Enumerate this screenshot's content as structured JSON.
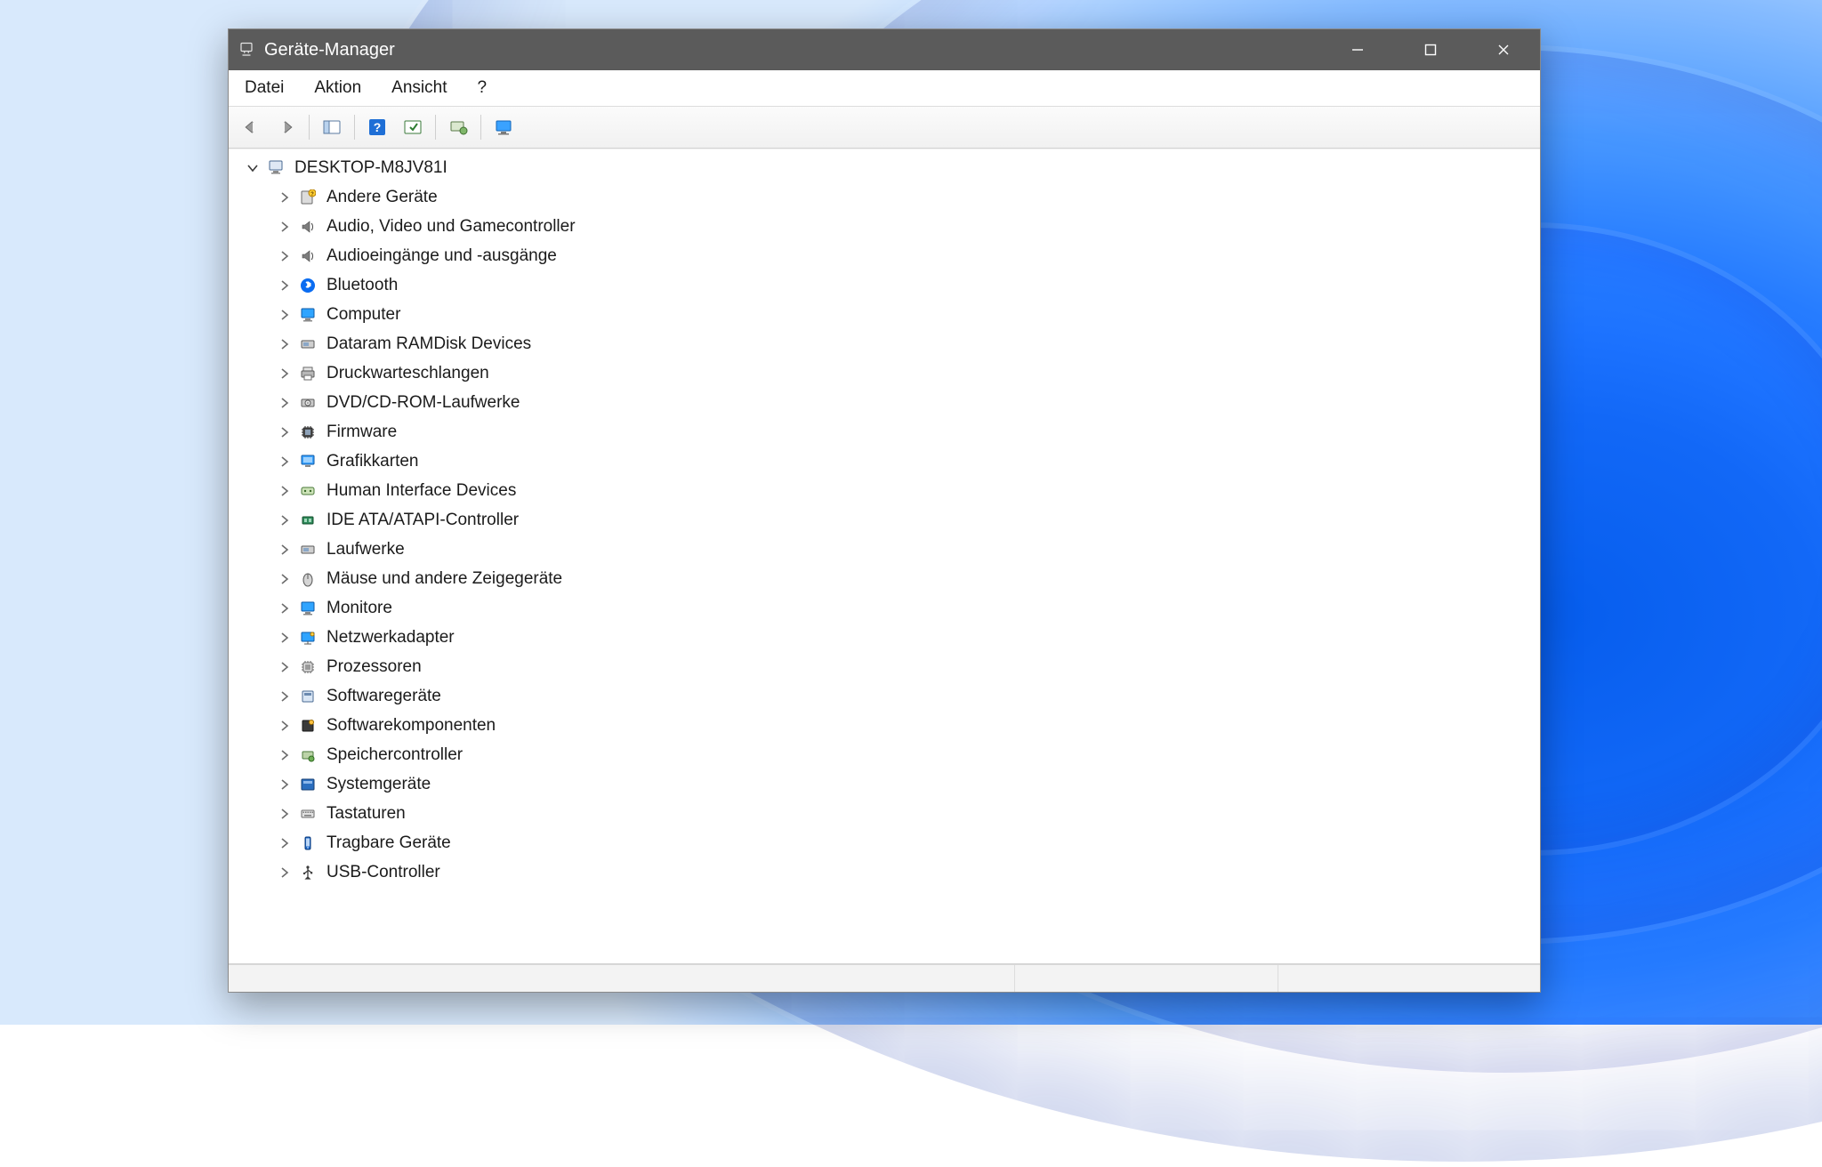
{
  "window": {
    "title": "Geräte-Manager"
  },
  "menu": {
    "file": "Datei",
    "action": "Aktion",
    "view": "Ansicht",
    "help": "?"
  },
  "tree": {
    "root": {
      "label": "DESKTOP-M8JV81I",
      "icon": "computer-icon"
    },
    "items": [
      {
        "label": "Andere Geräte",
        "icon": "unknown-device-icon"
      },
      {
        "label": "Audio, Video und Gamecontroller",
        "icon": "speaker-icon"
      },
      {
        "label": "Audioeingänge und -ausgänge",
        "icon": "speaker-icon"
      },
      {
        "label": "Bluetooth",
        "icon": "bluetooth-icon"
      },
      {
        "label": "Computer",
        "icon": "monitor-icon"
      },
      {
        "label": "Dataram RAMDisk Devices",
        "icon": "disk-icon"
      },
      {
        "label": "Druckwarteschlangen",
        "icon": "printer-icon"
      },
      {
        "label": "DVD/CD-ROM-Laufwerke",
        "icon": "optical-drive-icon"
      },
      {
        "label": "Firmware",
        "icon": "chip-icon"
      },
      {
        "label": "Grafikkarten",
        "icon": "display-adapter-icon"
      },
      {
        "label": "Human Interface Devices",
        "icon": "hid-icon"
      },
      {
        "label": "IDE ATA/ATAPI-Controller",
        "icon": "controller-icon"
      },
      {
        "label": "Laufwerke",
        "icon": "disk-icon"
      },
      {
        "label": "Mäuse und andere Zeigegeräte",
        "icon": "mouse-icon"
      },
      {
        "label": "Monitore",
        "icon": "monitor-icon"
      },
      {
        "label": "Netzwerkadapter",
        "icon": "network-icon"
      },
      {
        "label": "Prozessoren",
        "icon": "cpu-icon"
      },
      {
        "label": "Softwaregeräte",
        "icon": "software-device-icon"
      },
      {
        "label": "Softwarekomponenten",
        "icon": "software-component-icon"
      },
      {
        "label": "Speichercontroller",
        "icon": "storage-controller-icon"
      },
      {
        "label": "Systemgeräte",
        "icon": "system-device-icon"
      },
      {
        "label": "Tastaturen",
        "icon": "keyboard-icon"
      },
      {
        "label": "Tragbare Geräte",
        "icon": "portable-device-icon"
      },
      {
        "label": "USB-Controller",
        "icon": "usb-icon"
      }
    ]
  }
}
